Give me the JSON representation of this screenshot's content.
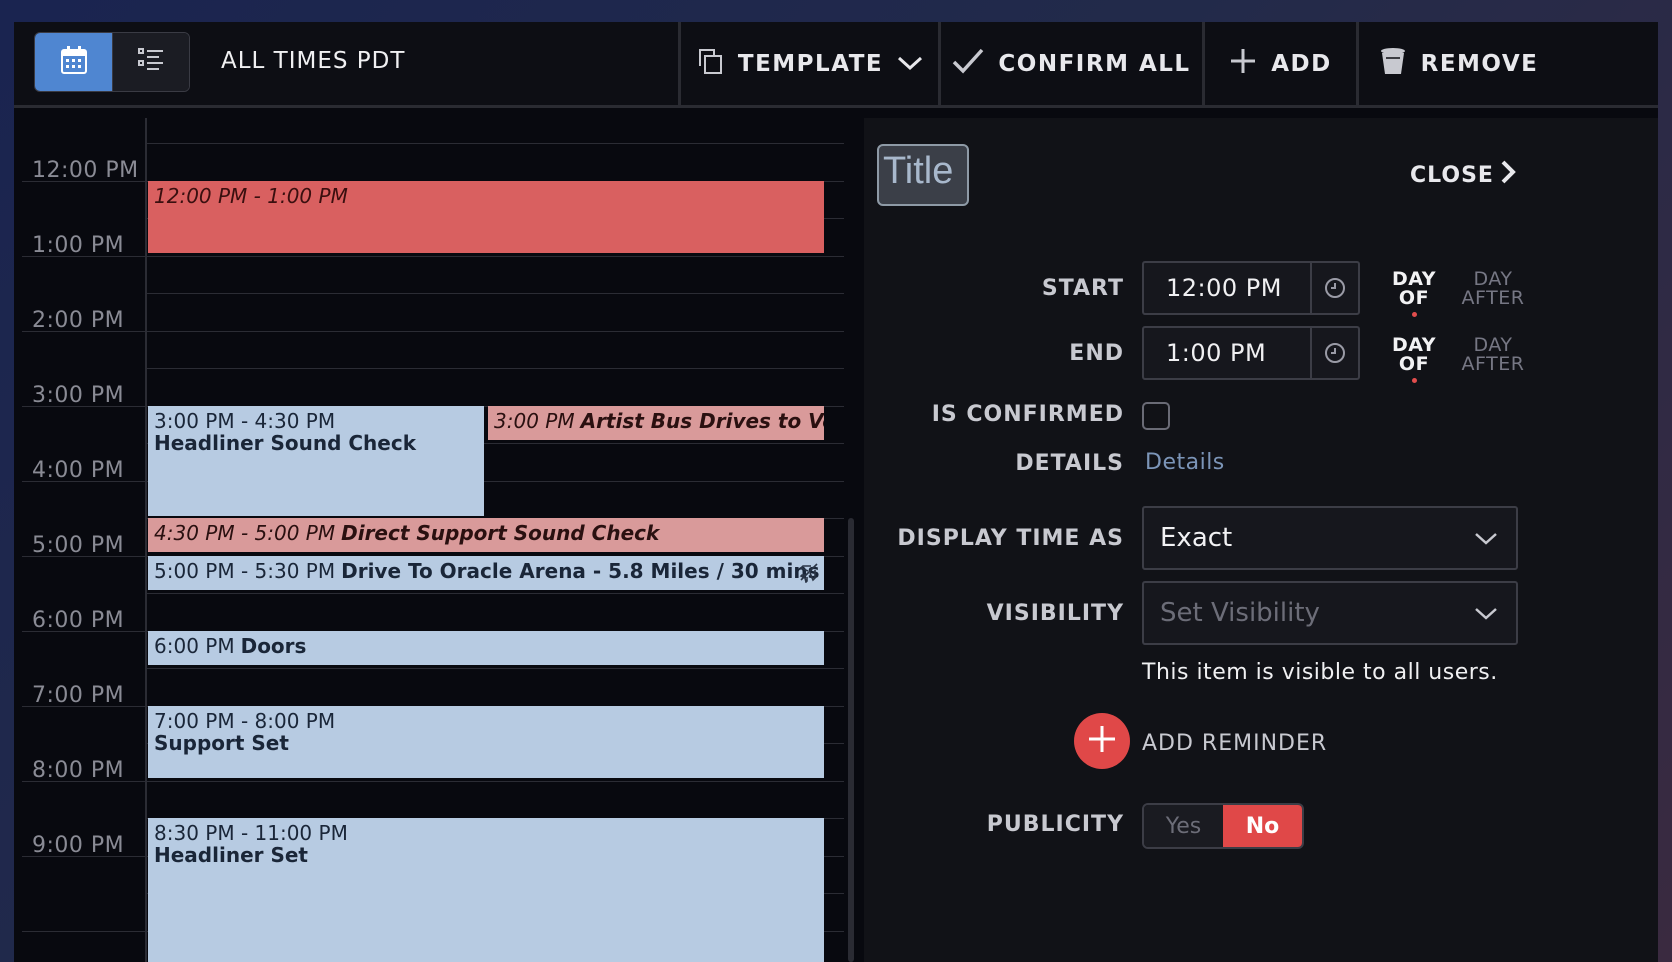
{
  "toolbar": {
    "timezone_label": "ALL TIMES PDT",
    "template_label": "TEMPLATE",
    "confirm_all_label": "CONFIRM ALL",
    "add_label": "ADD",
    "remove_label": "REMOVE"
  },
  "calendar": {
    "time_labels": [
      "12:00 PM",
      "1:00 PM",
      "2:00 PM",
      "3:00 PM",
      "4:00 PM",
      "5:00 PM",
      "6:00 PM",
      "7:00 PM",
      "8:00 PM",
      "9:00 PM"
    ],
    "events": [
      {
        "time": "12:00 PM - 1:00 PM",
        "title": "",
        "color": "#d96060"
      },
      {
        "time": "3:00 PM - 4:30 PM",
        "title": "Headliner Sound Check",
        "color": "#b7cbe2"
      },
      {
        "time": "3:00 PM",
        "title": "Artist Bus Drives to Venue",
        "color": "#d99a9a"
      },
      {
        "time": "4:30 PM - 5:00 PM",
        "title": "Direct Support Sound Check",
        "color": "#d99a9a"
      },
      {
        "time": "5:00 PM - 5:30 PM",
        "title": "Drive To Oracle Arena - 5.8 Miles / 30 mins",
        "icon": "airplane-icon",
        "color": "#b7cbe2"
      },
      {
        "time": "6:00 PM",
        "title": "Doors",
        "color": "#b7cbe2"
      },
      {
        "time": "7:00 PM - 8:00 PM",
        "title": "Support Set",
        "color": "#b7cbe2"
      },
      {
        "time": "8:30 PM - 11:00 PM",
        "title": "Headliner Set",
        "color": "#b7cbe2"
      }
    ]
  },
  "panel": {
    "title_placeholder": "Title",
    "close_label": "CLOSE",
    "start_label": "START",
    "start_value": "12:00 PM",
    "end_label": "END",
    "end_value": "1:00 PM",
    "day_of_line1": "DAY",
    "day_of_line2": "OF",
    "day_after_line1": "DAY",
    "day_after_line2": "AFTER",
    "is_confirmed_label": "IS CONFIRMED",
    "is_confirmed": false,
    "details_label": "DETAILS",
    "details_link": "Details",
    "display_time_label": "DISPLAY TIME AS",
    "display_time_value": "Exact",
    "visibility_label": "VISIBILITY",
    "visibility_placeholder": "Set Visibility",
    "visibility_note": "This item is visible to all users.",
    "add_reminder_label": "ADD REMINDER",
    "publicity_label": "PUBLICITY",
    "publicity_yes": "Yes",
    "publicity_no": "No",
    "publicity_selected": "No"
  },
  "colors": {
    "accent_blue": "#4f86d1",
    "accent_red": "#e04848",
    "event_blue": "#b7cbe2",
    "event_red": "#d96060",
    "event_red_light": "#d99a9a"
  }
}
